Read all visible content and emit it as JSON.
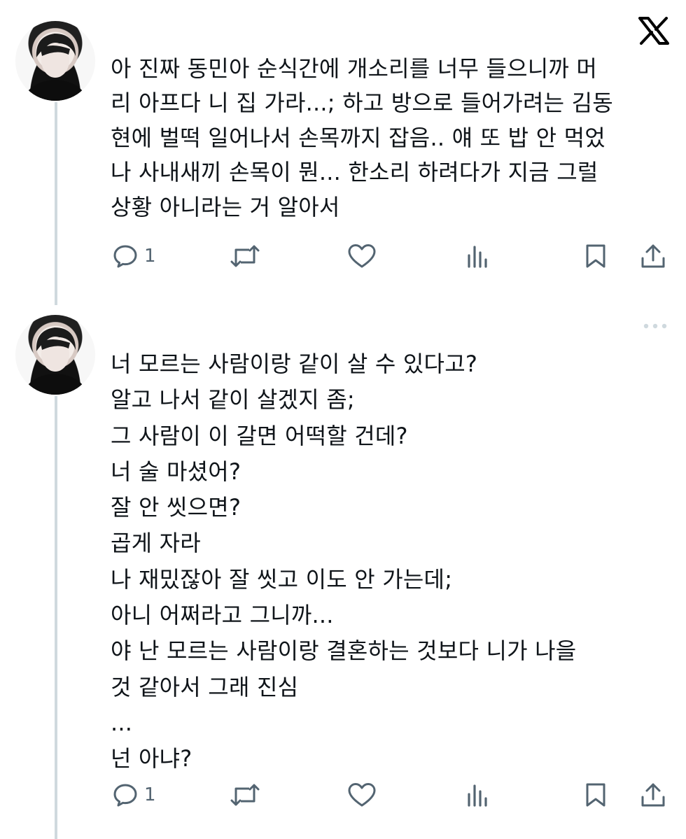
{
  "brand": {
    "logo_icon": "x-logo-icon"
  },
  "tweets": [
    {
      "text": "아 진짜 동민아 순식간에 개소리를 너무 들으니까 머\n리 아프다 니 집 가라...; 하고 방으로 들어가려는 김동\n현에 벌떡 일어나서 손목까지 잡음.. 얘 또 밥 안 먹었\n나 사내새끼 손목이 뭔... 한소리 하려다가 지금 그럴\n상황 아니라는 거 알아서",
      "reply_count": "1"
    },
    {
      "text": "너 모르는 사람이랑 같이 살 수 있다고?\n알고 나서 같이 살겠지 좀;\n그 사람이 이 갈면 어떡할 건데?\n너 술 마셨어?\n잘 안 씻으면?\n곱게 자라\n나 재밌잖아 잘 씻고 이도 안 가는데;\n아니 어쩌라고 그니까...\n야 난 모르는 사람이랑 결혼하는 것보다 니가 나을\n것 같아서 그래 진심\n...\n넌 아냐?",
      "reply_count": "1"
    }
  ],
  "colors": {
    "text": "#0f1419",
    "muted": "#536471",
    "thread_line": "#cfd9de"
  }
}
